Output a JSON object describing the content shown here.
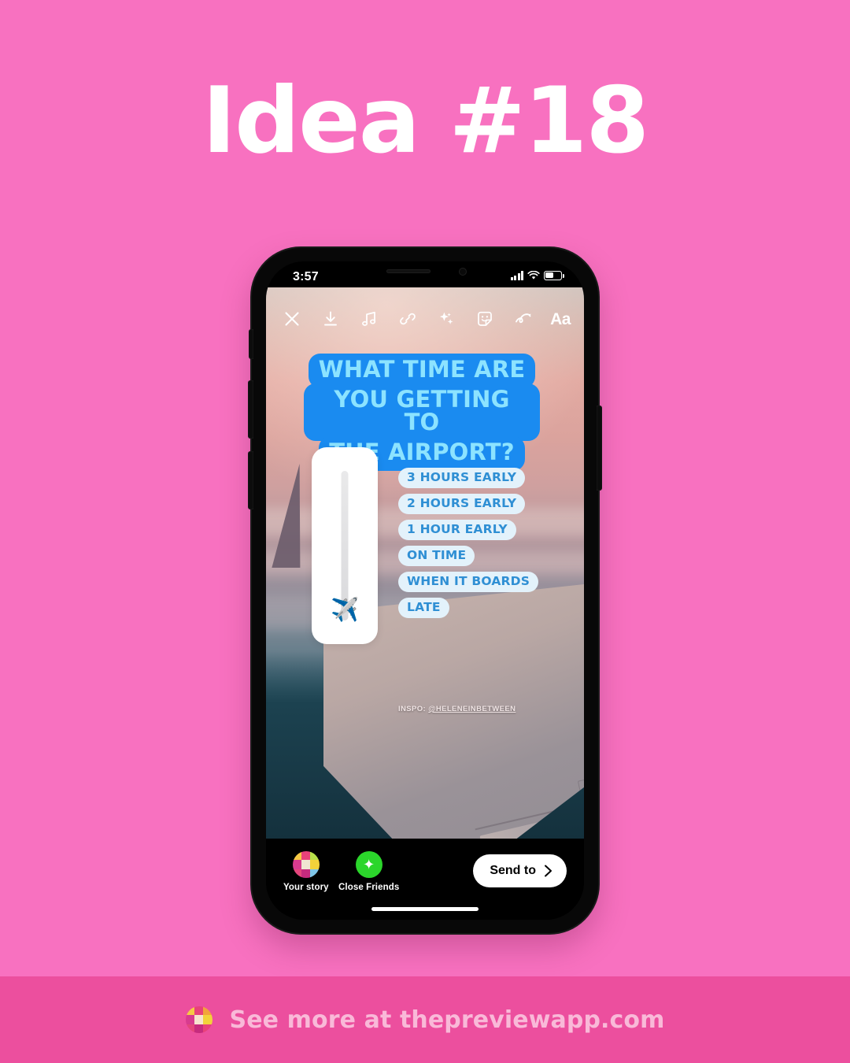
{
  "headline": "Idea #18",
  "theme": {
    "background_pink": "#F871C0",
    "footer_pink": "#EC4F9E",
    "footer_text": "#F9B9D8",
    "question_highlight": "#1A8BF0",
    "question_text": "#8CE3FF",
    "chip_background": "#E3F2FB",
    "chip_text": "#2F8FD4",
    "close_friends_green": "#2BD62B"
  },
  "phone": {
    "status_bar": {
      "time": "3:57",
      "signal_icon": "cellular-signal-icon",
      "wifi_icon": "wifi-icon",
      "battery_icon": "battery-icon"
    },
    "toolbar": [
      {
        "name": "close-icon",
        "label": "Close"
      },
      {
        "name": "download-icon",
        "label": "Save"
      },
      {
        "name": "music-note-icon",
        "label": "Music"
      },
      {
        "name": "link-icon",
        "label": "Link"
      },
      {
        "name": "sparkles-icon",
        "label": "Effects"
      },
      {
        "name": "sticker-icon",
        "label": "Stickers"
      },
      {
        "name": "draw-icon",
        "label": "Draw"
      },
      {
        "name": "text-tool-label",
        "label": "Aa"
      }
    ],
    "story": {
      "question_lines": [
        "WHAT TIME ARE",
        "YOU GETTING TO",
        "THE AIRPORT?"
      ],
      "slider": {
        "emoji": "✈️",
        "value_percent": 0
      },
      "answers": [
        "3 HOURS EARLY",
        "2 HOURS EARLY",
        "1 HOUR EARLY",
        "ON TIME",
        "WHEN IT BOARDS",
        "LATE"
      ],
      "credit_prefix": "INSPO: ",
      "credit_handle": "@HELENEINBETWEEN"
    },
    "action_bar": {
      "your_story_label": "Your story",
      "close_friends_label": "Close Friends",
      "close_friends_icon": "✦",
      "send_to_label": "Send to",
      "send_to_icon": "chevron-right-icon"
    }
  },
  "footer": {
    "text": "See more at thepreviewapp.com",
    "logo_name": "preview-app-logo"
  }
}
